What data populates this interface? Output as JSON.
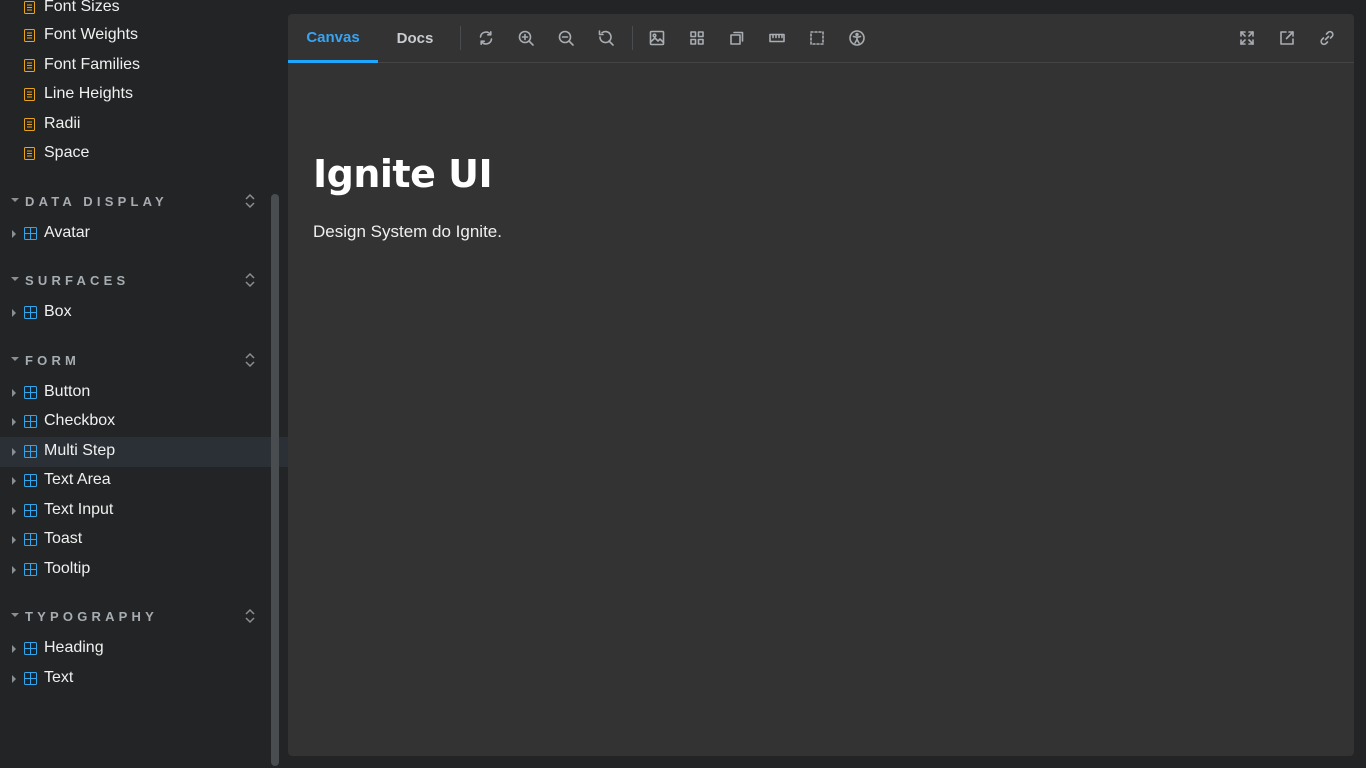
{
  "sidebar": {
    "doc_items": [
      {
        "label": "Font Sizes"
      },
      {
        "label": "Font Weights"
      },
      {
        "label": "Font Families"
      },
      {
        "label": "Line Heights"
      },
      {
        "label": "Radii"
      },
      {
        "label": "Space"
      }
    ],
    "groups": {
      "data_display": {
        "label": "DATA DISPLAY",
        "items": [
          {
            "label": "Avatar"
          }
        ]
      },
      "surfaces": {
        "label": "SURFACES",
        "items": [
          {
            "label": "Box"
          }
        ]
      },
      "form": {
        "label": "FORM",
        "items": [
          {
            "label": "Button"
          },
          {
            "label": "Checkbox"
          },
          {
            "label": "Multi Step"
          },
          {
            "label": "Text Area"
          },
          {
            "label": "Text Input"
          },
          {
            "label": "Toast"
          },
          {
            "label": "Tooltip"
          }
        ]
      },
      "typography": {
        "label": "TYPOGRAPHY",
        "items": [
          {
            "label": "Heading"
          },
          {
            "label": "Text"
          }
        ]
      }
    },
    "active_item": "Multi Step"
  },
  "toolbar": {
    "tabs": [
      {
        "label": "Canvas"
      },
      {
        "label": "Docs"
      }
    ],
    "active_tab": "Canvas",
    "icons": [
      "sync-icon",
      "zoom-in-icon",
      "zoom-out-icon",
      "zoom-reset-icon",
      "background-icon",
      "grid-icon",
      "viewport-icon",
      "measure-icon",
      "outline-icon",
      "accessibility-icon",
      "fullscreen-icon",
      "open-new-tab-icon",
      "copy-link-icon"
    ]
  },
  "preview": {
    "title": "Ignite UI",
    "description": "Design System do Ignite."
  },
  "colors": {
    "accent": "#1ea7fd",
    "doc_icon": "#e9a21b",
    "component_icon": "#2fa6ee",
    "sidebar_bg": "#222425",
    "canvas_bg": "#333333"
  }
}
